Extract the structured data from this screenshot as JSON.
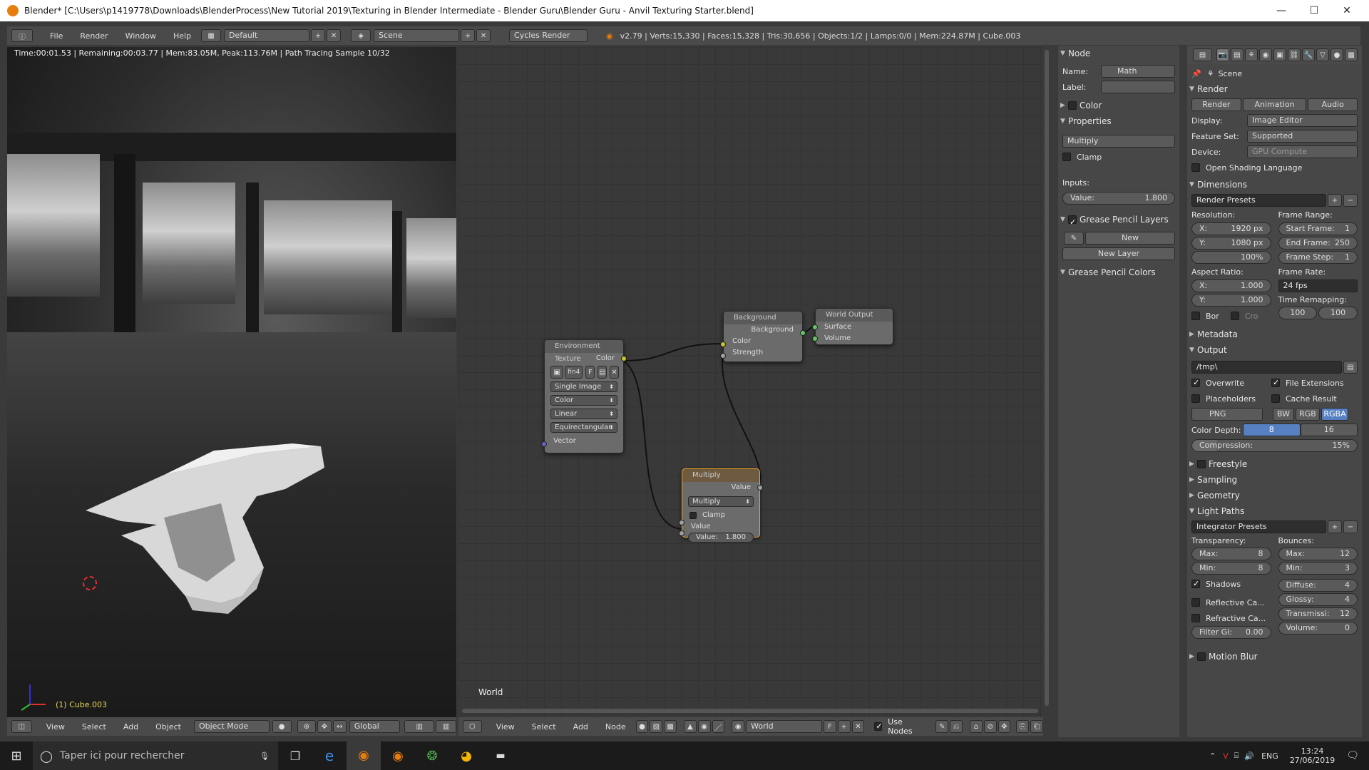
{
  "titlebar": {
    "title": "Blender* [C:\\Users\\p1419778\\Downloads\\BlenderProcess\\New Tutorial 2019\\Texturing in Blender Intermediate - Blender Guru\\Blender Guru - Anvil Texturing Starter.blend]",
    "minimize": "—",
    "maximize": "☐",
    "close": "✕"
  },
  "topbar": {
    "menus": [
      "File",
      "Render",
      "Window",
      "Help"
    ],
    "layout": "Default",
    "scene": "Scene",
    "engine": "Cycles Render",
    "stats": "v2.79 | Verts:15,330 | Faces:15,328 | Tris:30,656 | Objects:1/2 | Lamps:0/0 | Mem:224.87M | Cube.003"
  },
  "viewport": {
    "render_info": "Time:00:01.53 | Remaining:00:03.77 | Mem:83.05M, Peak:113.76M | Path Tracing Sample 10/32",
    "object_label": "(1) Cube.003"
  },
  "viewport_header": {
    "menus": [
      "View",
      "Select",
      "Add",
      "Object"
    ],
    "mode": "Object Mode",
    "orientation": "Global"
  },
  "node_editor": {
    "context": "World",
    "header_menus": [
      "View",
      "Select",
      "Add",
      "Node"
    ],
    "world_name": "World",
    "world_fake": "F",
    "use_nodes_label": "Use Nodes",
    "nodes": {
      "env_texture": {
        "title": "Environment Texture",
        "out_color": "Color",
        "image": "fin4",
        "image_f": "F",
        "source": "Single Image",
        "color_space": "Color",
        "interp": "Linear",
        "projection": "Equirectangular",
        "in_vector": "Vector"
      },
      "background": {
        "title": "Background",
        "out": "Background",
        "in_color": "Color",
        "in_strength": "Strength"
      },
      "world_output": {
        "title": "World Output",
        "surface": "Surface",
        "volume": "Volume"
      },
      "multiply": {
        "title": "Multiply",
        "out": "Value",
        "op": "Multiply",
        "clamp": "Clamp",
        "in_value": "Value",
        "value_label": "Value:",
        "value": "1.800"
      }
    }
  },
  "node_panel": {
    "node_title": "Node",
    "name_label": "Name:",
    "name_value": "Math",
    "label_label": "Label:",
    "color_title": "Color",
    "properties_title": "Properties",
    "operation": "Multiply",
    "clamp": "Clamp",
    "inputs_label": "Inputs:",
    "value_label": "Value:",
    "value": "1.800",
    "gp_layers_title": "Grease Pencil Layers",
    "gp_new": "New",
    "gp_new_layer": "New Layer",
    "gp_colors_title": "Grease Pencil Colors"
  },
  "props": {
    "scene": "Scene",
    "render_title": "Render",
    "render_btn": "Render",
    "animation_btn": "Animation",
    "audio_btn": "Audio",
    "display_label": "Display:",
    "display_value": "Image Editor",
    "feature_label": "Feature Set:",
    "feature_value": "Supported",
    "device_label": "Device:",
    "device_value": "GPU Compute",
    "osl": "Open Shading Language",
    "dimensions_title": "Dimensions",
    "render_presets": "Render Presets",
    "resolution_label": "Resolution:",
    "res_x_label": "X:",
    "res_x": "1920 px",
    "res_y_label": "Y:",
    "res_y": "1080 px",
    "res_pct": "100%",
    "frame_range_label": "Frame Range:",
    "start_label": "Start Frame:",
    "start": "1",
    "end_label": "End Frame:",
    "end": "250",
    "step_label": "Frame Step:",
    "step": "1",
    "aspect_label": "Aspect Ratio:",
    "aspect_x_label": "X:",
    "aspect_x": "1.000",
    "aspect_y_label": "Y:",
    "aspect_y": "1.000",
    "frame_rate_label": "Frame Rate:",
    "fps": "24 fps",
    "time_remap_label": "Time Remapping:",
    "remap_old": "100",
    "remap_new": "100",
    "border": "Bor",
    "crop": "Cro",
    "metadata_title": "Metadata",
    "output_title": "Output",
    "output_path": "/tmp\\",
    "overwrite": "Overwrite",
    "file_ext": "File Extensions",
    "placeholders": "Placeholders",
    "cache_result": "Cache Result",
    "format": "PNG",
    "bw": "BW",
    "rgb": "RGB",
    "rgba": "RGBA",
    "depth_label": "Color Depth:",
    "depth_8": "8",
    "depth_16": "16",
    "compression_label": "Compression:",
    "compression": "15%",
    "freestyle_title": "Freestyle",
    "sampling_title": "Sampling",
    "geometry_title": "Geometry",
    "lightpaths_title": "Light Paths",
    "integrator_presets": "Integrator Presets",
    "transparency_label": "Transparency:",
    "bounces_label": "Bounces:",
    "t_max_label": "Max:",
    "t_max": "8",
    "t_min_label": "Min:",
    "t_min": "8",
    "b_max_label": "Max:",
    "b_max": "12",
    "b_min_label": "Min:",
    "b_min": "3",
    "shadows": "Shadows",
    "diffuse_label": "Diffuse:",
    "diffuse": "4",
    "glossy_label": "Glossy:",
    "glossy": "4",
    "transmission_label": "Transmissi:",
    "transmission": "12",
    "volume_label": "Volume:",
    "volume": "0",
    "reflective_caustics": "Reflective Ca...",
    "refractive_caustics": "Refractive Ca...",
    "filter_glossy_label": "Filter Gl:",
    "filter_glossy": "0.00",
    "motion_blur_title": "Motion Blur"
  },
  "taskbar": {
    "search_placeholder": "Taper ici pour rechercher",
    "lang": "ENG",
    "time": "13:24",
    "date": "27/06/2019"
  },
  "colors": {
    "blender_orange": "#e87d0d",
    "selection_blue": "#5680c2",
    "socket_yellow": "#c7c729",
    "socket_green": "#63c763",
    "socket_grey": "#a1a1a1",
    "socket_blue": "#6363c7"
  }
}
